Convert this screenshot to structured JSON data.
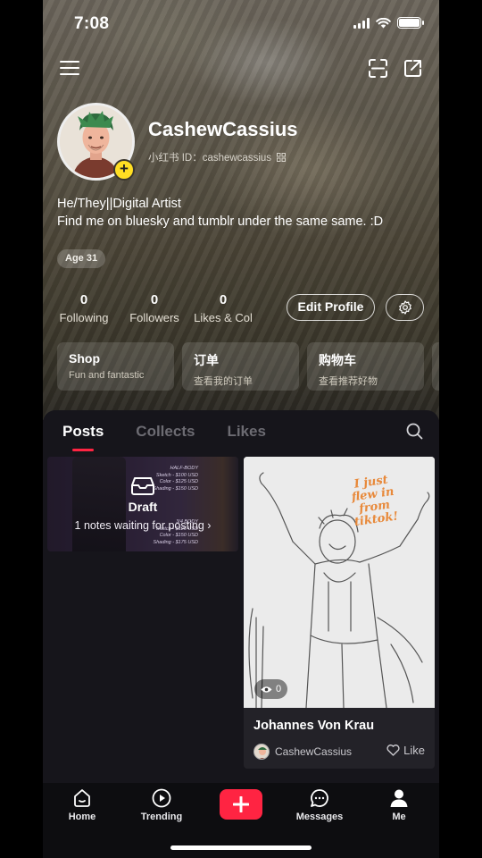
{
  "status_bar": {
    "time": "7:08"
  },
  "profile": {
    "username": "CashewCassius",
    "id_label": "小红书 ID：cashewcassius",
    "bio_line1": "He/They||Digital Artist",
    "bio_line2": "Find me on bluesky and tumblr under the same same. :D",
    "age_tag": "Age 31"
  },
  "stats": [
    {
      "value": "0",
      "label": "Following"
    },
    {
      "value": "0",
      "label": "Followers"
    },
    {
      "value": "0",
      "label": "Likes & Col"
    }
  ],
  "buttons": {
    "edit_profile": "Edit Profile"
  },
  "cards": [
    {
      "title": "Shop",
      "subtitle": "Fun and fantastic"
    },
    {
      "title": "订单",
      "subtitle": "查看我的订单"
    },
    {
      "title": "购物车",
      "subtitle": "查看推荐好物"
    }
  ],
  "tabs": [
    "Posts",
    "Collects",
    "Likes"
  ],
  "draft": {
    "title": "Draft",
    "subtitle": "1 notes waiting for posting",
    "price_text": [
      "HALF-BODY",
      "Sketch - $100 USD",
      "Color - $125 USD",
      "Shading - $150 USD",
      "",
      "",
      "3/4 BODY",
      "Sketch - $125 USD",
      "Color - $150 USD",
      "Shading - $175 USD"
    ]
  },
  "post": {
    "title": "Johannes Von Krau",
    "author": "CashewCassius",
    "views": "0",
    "like_label": "Like",
    "image_caption": [
      "I just",
      "flew in",
      "from",
      "tiktok!"
    ]
  },
  "nav": [
    {
      "label": "Home",
      "icon": "home-icon"
    },
    {
      "label": "Trending",
      "icon": "play-icon"
    },
    {
      "label": "",
      "icon": "plus-icon"
    },
    {
      "label": "Messages",
      "icon": "chat-icon"
    },
    {
      "label": "Me",
      "icon": "person-icon"
    }
  ],
  "colors": {
    "accent": "#ff2442",
    "badge": "#ffde23",
    "panel": "#16151b"
  }
}
